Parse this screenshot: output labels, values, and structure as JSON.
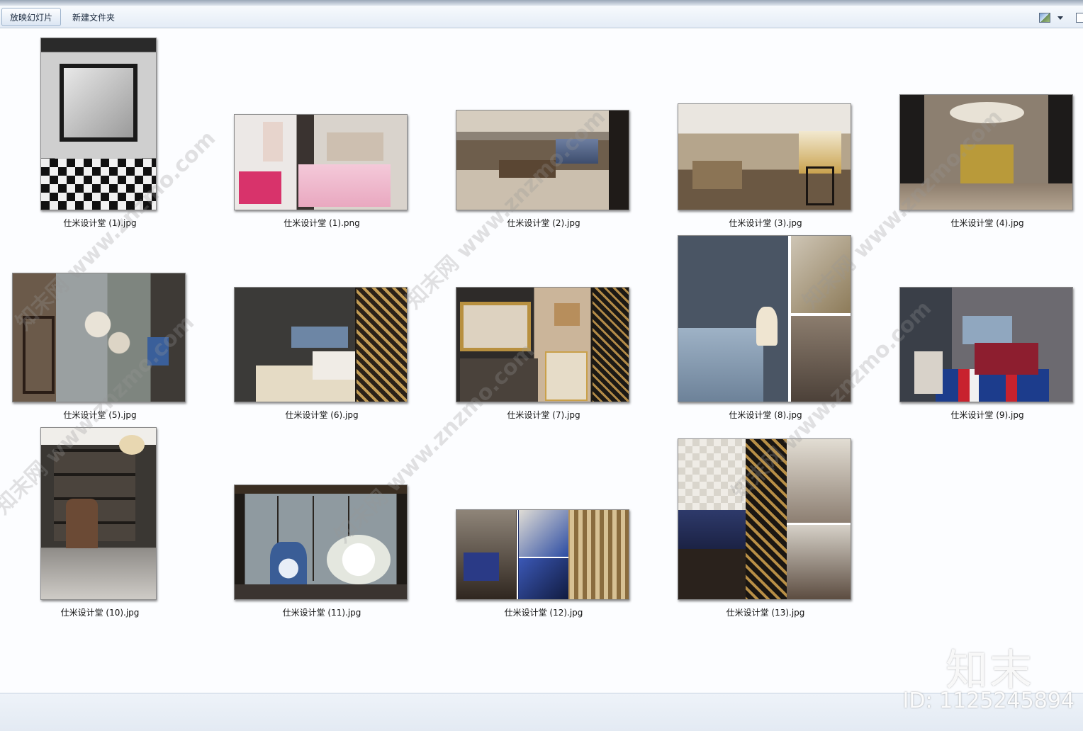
{
  "toolbar": {
    "slideshow_label": "放映幻灯片",
    "new_folder_label": "新建文件夹"
  },
  "files": [
    {
      "name": "仕米设计堂 (1).jpg",
      "icon": "image-thumbnail"
    },
    {
      "name": "仕米设计堂 (1).png",
      "icon": "image-thumbnail"
    },
    {
      "name": "仕米设计堂 (2).jpg",
      "icon": "image-thumbnail"
    },
    {
      "name": "仕米设计堂 (3).jpg",
      "icon": "image-thumbnail"
    },
    {
      "name": "仕米设计堂 (4).jpg",
      "icon": "image-thumbnail"
    },
    {
      "name": "仕米设计堂 (5).jpg",
      "icon": "image-thumbnail"
    },
    {
      "name": "仕米设计堂 (6).jpg",
      "icon": "image-thumbnail"
    },
    {
      "name": "仕米设计堂 (7).jpg",
      "icon": "image-thumbnail"
    },
    {
      "name": "仕米设计堂 (8).jpg",
      "icon": "image-thumbnail"
    },
    {
      "name": "仕米设计堂 (9).jpg",
      "icon": "image-thumbnail"
    },
    {
      "name": "仕米设计堂 (10).jpg",
      "icon": "image-thumbnail"
    },
    {
      "name": "仕米设计堂 (11).jpg",
      "icon": "image-thumbnail"
    },
    {
      "name": "仕米设计堂 (12).jpg",
      "icon": "image-thumbnail"
    },
    {
      "name": "仕米设计堂 (13).jpg",
      "icon": "image-thumbnail"
    }
  ],
  "watermark": {
    "logo": "知末",
    "id": "ID: 1125245894"
  }
}
